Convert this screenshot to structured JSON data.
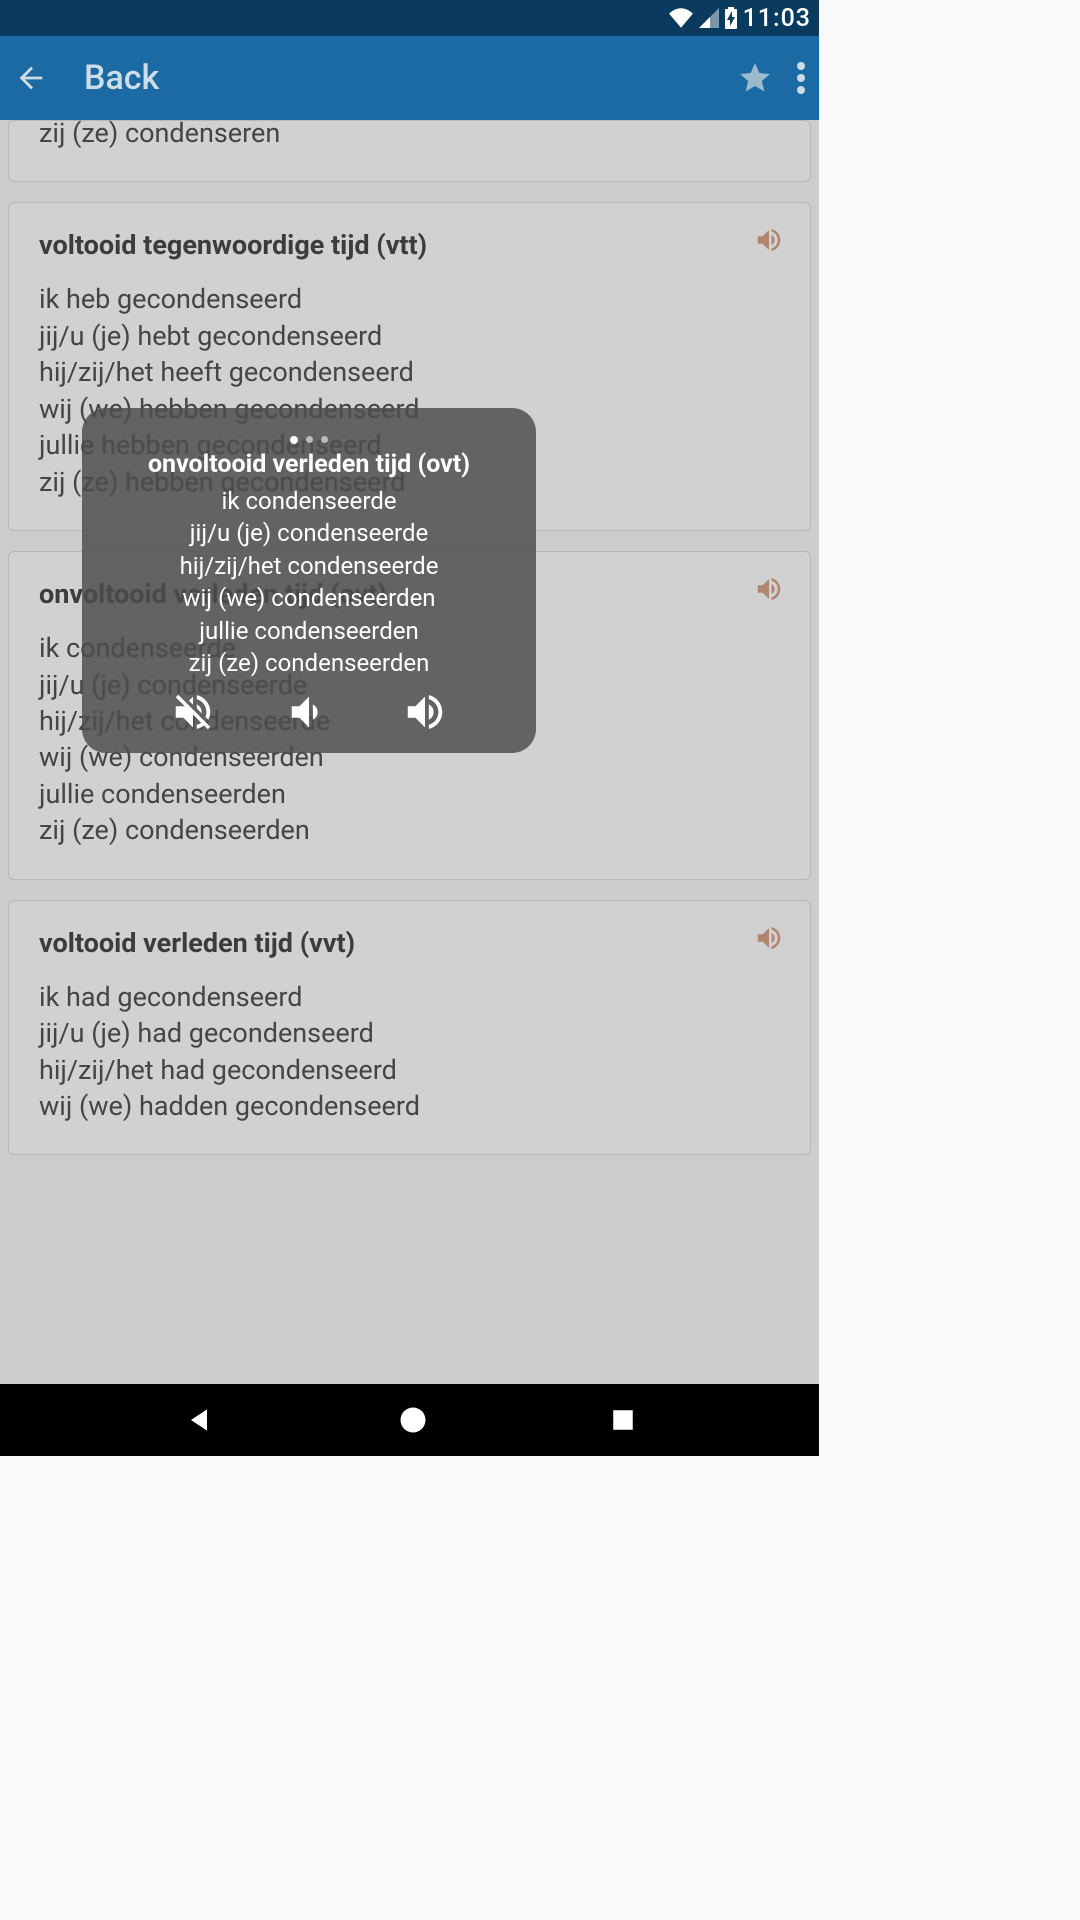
{
  "status": {
    "time": "11:03"
  },
  "appbar": {
    "title": "Back"
  },
  "cards": {
    "ott_last": "zij (ze) condenseren",
    "vtt": {
      "title": "voltooid tegenwoordige tijd (vtt)",
      "l0": "ik heb gecondenseerd",
      "l1": "jij/u (je) hebt gecondenseerd",
      "l2": "hij/zij/het heeft gecondenseerd",
      "l3": "wij (we) hebben gecondenseerd",
      "l4": "jullie hebben gecondenseerd",
      "l5": "zij (ze) hebben gecondenseerd"
    },
    "ovt": {
      "title": "onvoltooid verleden tijd (ovt)",
      "l0": "ik condenseerde",
      "l1": "jij/u (je) condenseerde",
      "l2": "hij/zij/het condenseerde",
      "l3": "wij (we) condenseerden",
      "l4": "jullie condenseerden",
      "l5": "zij (ze) condenseerden"
    },
    "vvt": {
      "title": "voltooid verleden tijd (vvt)",
      "l0": "ik had gecondenseerd",
      "l1": "jij/u (je) had gecondenseerd",
      "l2": "hij/zij/het had gecondenseerd",
      "l3": "wij (we) hadden gecondenseerd"
    }
  },
  "popup": {
    "title": "onvoltooid verleden tijd (ovt)",
    "l0": "ik condenseerde",
    "l1": "jij/u (je) condenseerde",
    "l2": "hij/zij/het condenseerde",
    "l3": "wij (we) condenseerden",
    "l4": "jullie condenseerden",
    "l5": "zij (ze) condenseerden"
  }
}
